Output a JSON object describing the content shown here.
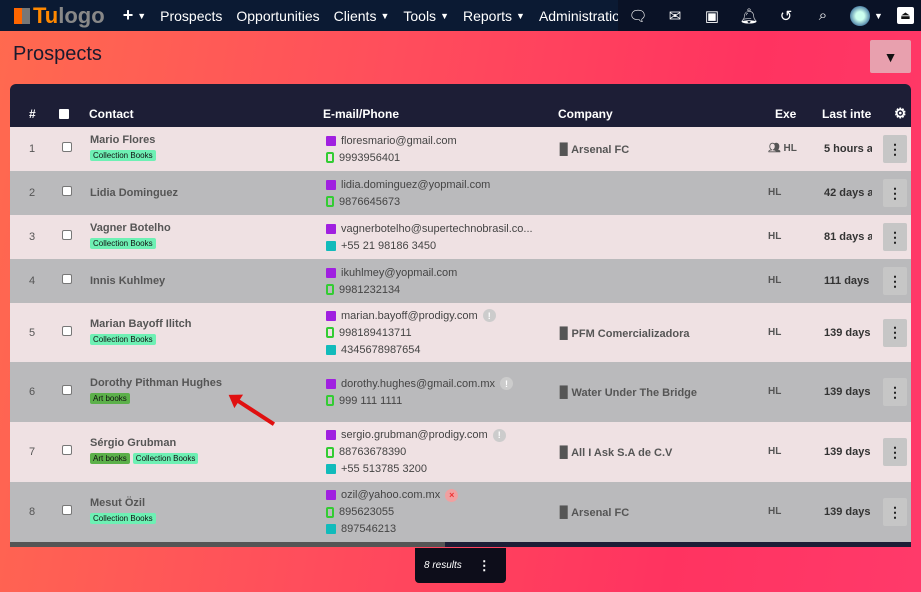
{
  "nav": {
    "logo": "Tu logo",
    "logo_a": "Tu",
    "logo_b": "logo",
    "plus": "+",
    "items": [
      "Prospects",
      "Opportunities",
      "Clients",
      "Tools",
      "Reports",
      "Administration"
    ]
  },
  "page": {
    "title": "Prospects",
    "results": "8 results"
  },
  "columns": {
    "num": "#",
    "contact": "Contact",
    "email": "E-mail/Phone",
    "company": "Company",
    "exe": "Exe",
    "last": "Last inte"
  },
  "rows": [
    {
      "n": "1",
      "name": "Mario Flores",
      "tags": [
        "Collection Books"
      ],
      "email": "floresmario@gmail.com",
      "mobile": "9993956401",
      "phone": "",
      "company": "Arsenal FC",
      "exe": "HL",
      "last": "5 hours a",
      "exe_icon": true
    },
    {
      "n": "2",
      "name": "Lidia Dominguez",
      "tags": [],
      "email": "lidia.dominguez@yopmail.com",
      "mobile": "9876645673",
      "phone": "",
      "company": "",
      "exe": "HL",
      "last": "42 days a"
    },
    {
      "n": "3",
      "name": "Vagner Botelho",
      "tags": [
        "Collection Books"
      ],
      "email": "vagnerbotelho@supertechnobrasil.co...",
      "mobile": "",
      "phone": "+55 21 98186 3450",
      "company": "",
      "exe": "HL",
      "last": "81 days a"
    },
    {
      "n": "4",
      "name": "Innis Kuhlmey",
      "tags": [],
      "email": "ikuhlmey@yopmail.com",
      "mobile": "9981232134",
      "phone": "",
      "company": "",
      "exe": "HL",
      "last": "111 days"
    },
    {
      "n": "5",
      "name": "Marian Bayoff Ilitch",
      "tags": [
        "Collection Books"
      ],
      "email": "marian.bayoff@prodigy.com",
      "email_flag": "!",
      "mobile": "998189413711",
      "phone": "4345678987654",
      "company": "PFM Comercializadora",
      "exe": "HL",
      "last": "139 days"
    },
    {
      "n": "6",
      "name": "Dorothy Pithman Hughes",
      "tags": [
        "Art books"
      ],
      "email": "dorothy.hughes@gmail.com.mx",
      "email_flag": "!",
      "mobile": "999 111 1111",
      "phone": "",
      "company": "Water Under The Bridge",
      "exe": "HL",
      "last": "139 days"
    },
    {
      "n": "7",
      "name": "Sérgio Grubman",
      "tags": [
        "Art books",
        "Collection Books"
      ],
      "email": "sergio.grubman@prodigy.com",
      "email_flag": "!",
      "mobile": "88763678390",
      "phone": "+55 513785 3200",
      "company": "All I Ask S.A de C.V",
      "exe": "HL",
      "last": "139 days"
    },
    {
      "n": "8",
      "name": "Mesut Özil",
      "tags": [
        "Collection Books"
      ],
      "email": "ozil@yahoo.com.mx",
      "email_flag": "×",
      "email_flag_error": true,
      "mobile": "895623055",
      "phone": "897546213",
      "company": "Arsenal FC",
      "exe": "HL",
      "last": "139 days"
    }
  ]
}
